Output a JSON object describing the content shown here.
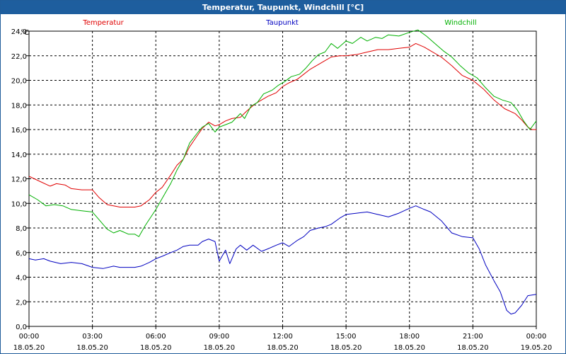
{
  "window": {
    "title": "Temperatur, Taupunkt, Windchill [°C]"
  },
  "chart_data": {
    "type": "line",
    "title": "Temperatur, Taupunkt, Windchill [°C]",
    "ylabel": "°C",
    "xlabel": "",
    "ylim": [
      0,
      24
    ],
    "xlim": [
      0,
      24
    ],
    "grid": true,
    "legend": "top",
    "y_ticks": [
      "0,0",
      "2,0",
      "4,0",
      "6,0",
      "8,0",
      "10,0",
      "12,0",
      "14,0",
      "16,0",
      "18,0",
      "20,0",
      "22,0",
      "24,0"
    ],
    "x_ticks": [
      {
        "time": "00:00",
        "date": "18.05.20"
      },
      {
        "time": "03:00",
        "date": "18.05.20"
      },
      {
        "time": "06:00",
        "date": "18.05.20"
      },
      {
        "time": "09:00",
        "date": "18.05.20"
      },
      {
        "time": "12:00",
        "date": "18.05.20"
      },
      {
        "time": "15:00",
        "date": "18.05.20"
      },
      {
        "time": "18:00",
        "date": "18.05.20"
      },
      {
        "time": "21:00",
        "date": "18.05.20"
      },
      {
        "time": "00:00",
        "date": "19.05.20"
      }
    ],
    "series": [
      {
        "name": "Temperatur",
        "color": "#e00000",
        "points": [
          [
            0,
            12.2
          ],
          [
            0.5,
            11.8
          ],
          [
            1,
            11.4
          ],
          [
            1.3,
            11.6
          ],
          [
            1.7,
            11.5
          ],
          [
            2,
            11.2
          ],
          [
            2.5,
            11.1
          ],
          [
            3,
            11.1
          ],
          [
            3.3,
            10.5
          ],
          [
            3.7,
            9.9
          ],
          [
            4,
            9.8
          ],
          [
            4.3,
            9.7
          ],
          [
            4.7,
            9.7
          ],
          [
            5,
            9.7
          ],
          [
            5.3,
            9.8
          ],
          [
            5.7,
            10.3
          ],
          [
            6,
            10.9
          ],
          [
            6.3,
            11.3
          ],
          [
            6.7,
            12.3
          ],
          [
            7,
            13.1
          ],
          [
            7.3,
            13.6
          ],
          [
            7.6,
            14.6
          ],
          [
            8,
            15.6
          ],
          [
            8.2,
            16.1
          ],
          [
            8.5,
            16.6
          ],
          [
            8.8,
            16.3
          ],
          [
            9,
            16.4
          ],
          [
            9.3,
            16.7
          ],
          [
            9.6,
            16.9
          ],
          [
            10,
            17.0
          ],
          [
            10.3,
            17.5
          ],
          [
            10.7,
            18.1
          ],
          [
            11,
            18.4
          ],
          [
            11.3,
            18.7
          ],
          [
            11.7,
            19.0
          ],
          [
            12,
            19.5
          ],
          [
            12.3,
            19.8
          ],
          [
            12.7,
            20.1
          ],
          [
            13,
            20.5
          ],
          [
            13.3,
            20.9
          ],
          [
            13.7,
            21.3
          ],
          [
            14,
            21.6
          ],
          [
            14.3,
            21.9
          ],
          [
            14.7,
            22.0
          ],
          [
            15,
            22.0
          ],
          [
            15.5,
            22.1
          ],
          [
            16,
            22.3
          ],
          [
            16.5,
            22.5
          ],
          [
            17,
            22.5
          ],
          [
            17.5,
            22.6
          ],
          [
            18,
            22.7
          ],
          [
            18.3,
            23.0
          ],
          [
            18.7,
            22.7
          ],
          [
            19,
            22.4
          ],
          [
            19.5,
            21.9
          ],
          [
            20,
            21.2
          ],
          [
            20.5,
            20.4
          ],
          [
            21,
            20.0
          ],
          [
            21.5,
            19.3
          ],
          [
            22,
            18.4
          ],
          [
            22.5,
            17.7
          ],
          [
            23,
            17.3
          ],
          [
            23.3,
            16.8
          ],
          [
            23.6,
            16.2
          ],
          [
            23.8,
            16.0
          ],
          [
            24,
            16.0
          ]
        ]
      },
      {
        "name": "Taupunkt",
        "color": "#0000c0",
        "points": [
          [
            0,
            5.5
          ],
          [
            0.3,
            5.4
          ],
          [
            0.7,
            5.5
          ],
          [
            1,
            5.3
          ],
          [
            1.5,
            5.1
          ],
          [
            2,
            5.2
          ],
          [
            2.5,
            5.1
          ],
          [
            3,
            4.8
          ],
          [
            3.5,
            4.7
          ],
          [
            4,
            4.9
          ],
          [
            4.3,
            4.8
          ],
          [
            4.7,
            4.8
          ],
          [
            5,
            4.8
          ],
          [
            5.3,
            4.9
          ],
          [
            5.7,
            5.2
          ],
          [
            6,
            5.5
          ],
          [
            6.3,
            5.7
          ],
          [
            6.7,
            6.0
          ],
          [
            7,
            6.2
          ],
          [
            7.3,
            6.5
          ],
          [
            7.6,
            6.6
          ],
          [
            8,
            6.6
          ],
          [
            8.2,
            6.9
          ],
          [
            8.5,
            7.1
          ],
          [
            8.8,
            6.9
          ],
          [
            9,
            5.3
          ],
          [
            9.3,
            6.2
          ],
          [
            9.5,
            5.1
          ],
          [
            9.8,
            6.3
          ],
          [
            10,
            6.6
          ],
          [
            10.3,
            6.2
          ],
          [
            10.6,
            6.6
          ],
          [
            11,
            6.1
          ],
          [
            11.3,
            6.3
          ],
          [
            11.7,
            6.6
          ],
          [
            12,
            6.8
          ],
          [
            12.3,
            6.5
          ],
          [
            12.7,
            7.0
          ],
          [
            13,
            7.3
          ],
          [
            13.3,
            7.8
          ],
          [
            13.7,
            8.0
          ],
          [
            14,
            8.1
          ],
          [
            14.3,
            8.3
          ],
          [
            14.7,
            8.8
          ],
          [
            15,
            9.1
          ],
          [
            15.5,
            9.2
          ],
          [
            16,
            9.3
          ],
          [
            16.5,
            9.1
          ],
          [
            17,
            8.9
          ],
          [
            17.5,
            9.2
          ],
          [
            18,
            9.6
          ],
          [
            18.3,
            9.8
          ],
          [
            18.7,
            9.5
          ],
          [
            19,
            9.3
          ],
          [
            19.5,
            8.6
          ],
          [
            20,
            7.6
          ],
          [
            20.5,
            7.3
          ],
          [
            21,
            7.2
          ],
          [
            21.3,
            6.3
          ],
          [
            21.6,
            5.0
          ],
          [
            22,
            3.7
          ],
          [
            22.3,
            2.8
          ],
          [
            22.6,
            1.3
          ],
          [
            22.8,
            1.0
          ],
          [
            23,
            1.1
          ],
          [
            23.3,
            1.7
          ],
          [
            23.6,
            2.5
          ],
          [
            24,
            2.6
          ]
        ]
      },
      {
        "name": "Windchill",
        "color": "#00b000",
        "points": [
          [
            0,
            10.7
          ],
          [
            0.4,
            10.3
          ],
          [
            0.8,
            9.8
          ],
          [
            1.2,
            9.9
          ],
          [
            1.6,
            9.8
          ],
          [
            2,
            9.5
          ],
          [
            2.5,
            9.4
          ],
          [
            3,
            9.3
          ],
          [
            3.3,
            8.7
          ],
          [
            3.7,
            7.9
          ],
          [
            4,
            7.6
          ],
          [
            4.3,
            7.8
          ],
          [
            4.7,
            7.5
          ],
          [
            5,
            7.5
          ],
          [
            5.2,
            7.3
          ],
          [
            5.5,
            8.2
          ],
          [
            6,
            9.5
          ],
          [
            6.3,
            10.4
          ],
          [
            6.7,
            11.6
          ],
          [
            7,
            12.7
          ],
          [
            7.3,
            13.6
          ],
          [
            7.6,
            14.9
          ],
          [
            8,
            15.8
          ],
          [
            8.2,
            16.2
          ],
          [
            8.5,
            16.5
          ],
          [
            8.8,
            15.8
          ],
          [
            9,
            16.2
          ],
          [
            9.3,
            16.4
          ],
          [
            9.6,
            16.6
          ],
          [
            10,
            17.3
          ],
          [
            10.2,
            16.9
          ],
          [
            10.5,
            17.9
          ],
          [
            10.8,
            18.2
          ],
          [
            11.1,
            18.9
          ],
          [
            11.5,
            19.2
          ],
          [
            11.8,
            19.6
          ],
          [
            12.1,
            19.9
          ],
          [
            12.4,
            20.3
          ],
          [
            12.8,
            20.5
          ],
          [
            13.1,
            21.0
          ],
          [
            13.4,
            21.6
          ],
          [
            13.7,
            22.1
          ],
          [
            14,
            22.3
          ],
          [
            14.3,
            23.0
          ],
          [
            14.6,
            22.6
          ],
          [
            15,
            23.2
          ],
          [
            15.3,
            23.0
          ],
          [
            15.7,
            23.5
          ],
          [
            16,
            23.2
          ],
          [
            16.4,
            23.5
          ],
          [
            16.7,
            23.4
          ],
          [
            17,
            23.7
          ],
          [
            17.5,
            23.6
          ],
          [
            18,
            23.9
          ],
          [
            18.4,
            24.1
          ],
          [
            18.8,
            23.6
          ],
          [
            19.2,
            23.0
          ],
          [
            19.6,
            22.4
          ],
          [
            20,
            21.9
          ],
          [
            20.4,
            21.2
          ],
          [
            20.8,
            20.6
          ],
          [
            21.2,
            20.2
          ],
          [
            21.6,
            19.4
          ],
          [
            22,
            18.7
          ],
          [
            22.4,
            18.4
          ],
          [
            22.8,
            18.2
          ],
          [
            23.1,
            17.6
          ],
          [
            23.4,
            16.7
          ],
          [
            23.7,
            16.0
          ],
          [
            24,
            16.7
          ]
        ]
      }
    ]
  }
}
